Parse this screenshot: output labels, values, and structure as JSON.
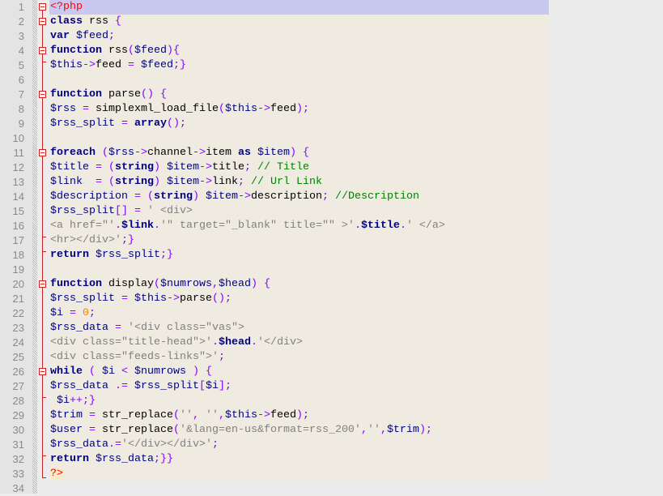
{
  "editor": {
    "colors": {
      "keyword": "#000080",
      "variable": "#000080",
      "operator": "#8000ff",
      "string": "#808080",
      "comment": "#008000",
      "php_tag": "#ff0000",
      "number": "#ff8000",
      "current_line": "#c9c8f0",
      "code_background": "#efebe0"
    },
    "current_line": 1,
    "fold_starts": [
      1,
      2,
      4,
      7,
      11,
      20,
      26
    ],
    "fold_ends": [
      5,
      17,
      18,
      28,
      32,
      33
    ],
    "lines": [
      [
        [
          "t",
          "<?php"
        ]
      ],
      [
        [
          "k",
          "class"
        ],
        [
          "d",
          " rss "
        ],
        [
          "o",
          "{"
        ]
      ],
      [
        [
          "k",
          "var"
        ],
        [
          "d",
          " "
        ],
        [
          "v",
          "$feed"
        ],
        [
          "o",
          ";"
        ]
      ],
      [
        [
          "k",
          "function"
        ],
        [
          "d",
          " rss"
        ],
        [
          "o",
          "("
        ],
        [
          "v",
          "$feed"
        ],
        [
          "o",
          "){"
        ]
      ],
      [
        [
          "v",
          "$this"
        ],
        [
          "o",
          "->"
        ],
        [
          "d",
          "feed "
        ],
        [
          "o",
          "="
        ],
        [
          "d",
          " "
        ],
        [
          "v",
          "$feed"
        ],
        [
          "o",
          ";}"
        ]
      ],
      [],
      [
        [
          "k",
          "function"
        ],
        [
          "d",
          " parse"
        ],
        [
          "o",
          "()"
        ],
        [
          "d",
          " "
        ],
        [
          "o",
          "{"
        ]
      ],
      [
        [
          "v",
          "$rss"
        ],
        [
          "d",
          " "
        ],
        [
          "o",
          "="
        ],
        [
          "d",
          " simplexml_load_file"
        ],
        [
          "o",
          "("
        ],
        [
          "v",
          "$this"
        ],
        [
          "o",
          "->"
        ],
        [
          "d",
          "feed"
        ],
        [
          "o",
          ");"
        ]
      ],
      [
        [
          "v",
          "$rss_split"
        ],
        [
          "d",
          " "
        ],
        [
          "o",
          "="
        ],
        [
          "d",
          " "
        ],
        [
          "k",
          "array"
        ],
        [
          "o",
          "();"
        ]
      ],
      [],
      [
        [
          "k",
          "foreach"
        ],
        [
          "d",
          " "
        ],
        [
          "o",
          "("
        ],
        [
          "v",
          "$rss"
        ],
        [
          "o",
          "->"
        ],
        [
          "d",
          "channel"
        ],
        [
          "o",
          "->"
        ],
        [
          "d",
          "item "
        ],
        [
          "k",
          "as"
        ],
        [
          "d",
          " "
        ],
        [
          "v",
          "$item"
        ],
        [
          "o",
          ")"
        ],
        [
          "d",
          " "
        ],
        [
          "o",
          "{"
        ]
      ],
      [
        [
          "v",
          "$title"
        ],
        [
          "d",
          " "
        ],
        [
          "o",
          "="
        ],
        [
          "d",
          " "
        ],
        [
          "o",
          "("
        ],
        [
          "k",
          "string"
        ],
        [
          "o",
          ")"
        ],
        [
          "d",
          " "
        ],
        [
          "v",
          "$item"
        ],
        [
          "o",
          "->"
        ],
        [
          "d",
          "title"
        ],
        [
          "o",
          ";"
        ],
        [
          "d",
          " "
        ],
        [
          "c",
          "// Title"
        ]
      ],
      [
        [
          "v",
          "$link"
        ],
        [
          "d",
          "  "
        ],
        [
          "o",
          "="
        ],
        [
          "d",
          " "
        ],
        [
          "o",
          "("
        ],
        [
          "k",
          "string"
        ],
        [
          "o",
          ")"
        ],
        [
          "d",
          " "
        ],
        [
          "v",
          "$item"
        ],
        [
          "o",
          "->"
        ],
        [
          "d",
          "link"
        ],
        [
          "o",
          ";"
        ],
        [
          "d",
          " "
        ],
        [
          "c",
          "// Url Link"
        ]
      ],
      [
        [
          "v",
          "$description"
        ],
        [
          "d",
          " "
        ],
        [
          "o",
          "="
        ],
        [
          "d",
          " "
        ],
        [
          "o",
          "("
        ],
        [
          "k",
          "string"
        ],
        [
          "o",
          ")"
        ],
        [
          "d",
          " "
        ],
        [
          "v",
          "$item"
        ],
        [
          "o",
          "->"
        ],
        [
          "d",
          "description"
        ],
        [
          "o",
          ";"
        ],
        [
          "d",
          " "
        ],
        [
          "c",
          "//Description"
        ]
      ],
      [
        [
          "v",
          "$rss_split"
        ],
        [
          "o",
          "[]"
        ],
        [
          "d",
          " "
        ],
        [
          "o",
          "="
        ],
        [
          "d",
          " "
        ],
        [
          "s",
          "' <div>"
        ]
      ],
      [
        [
          "s",
          "<a href=\"'"
        ],
        [
          "o",
          "."
        ],
        [
          "k",
          "$link"
        ],
        [
          "o",
          "."
        ],
        [
          "s",
          "'\" target=\"_blank\" title=\"\" >'"
        ],
        [
          "o",
          "."
        ],
        [
          "k",
          "$title"
        ],
        [
          "o",
          "."
        ],
        [
          "s",
          "' </a>"
        ]
      ],
      [
        [
          "s",
          "<hr></div>'"
        ],
        [
          "o",
          ";}"
        ]
      ],
      [
        [
          "k",
          "return"
        ],
        [
          "d",
          " "
        ],
        [
          "v",
          "$rss_split"
        ],
        [
          "o",
          ";}"
        ]
      ],
      [],
      [
        [
          "k",
          "function"
        ],
        [
          "d",
          " display"
        ],
        [
          "o",
          "("
        ],
        [
          "v",
          "$numrows"
        ],
        [
          "o",
          ","
        ],
        [
          "v",
          "$head"
        ],
        [
          "o",
          ")"
        ],
        [
          "d",
          " "
        ],
        [
          "o",
          "{"
        ]
      ],
      [
        [
          "v",
          "$rss_split"
        ],
        [
          "d",
          " "
        ],
        [
          "o",
          "="
        ],
        [
          "d",
          " "
        ],
        [
          "v",
          "$this"
        ],
        [
          "o",
          "->"
        ],
        [
          "d",
          "parse"
        ],
        [
          "o",
          "();"
        ]
      ],
      [
        [
          "v",
          "$i"
        ],
        [
          "d",
          " "
        ],
        [
          "o",
          "="
        ],
        [
          "d",
          " "
        ],
        [
          "n",
          "0"
        ],
        [
          "o",
          ";"
        ]
      ],
      [
        [
          "v",
          "$rss_data"
        ],
        [
          "d",
          " "
        ],
        [
          "o",
          "="
        ],
        [
          "d",
          " "
        ],
        [
          "s",
          "'<div class=\"vas\">"
        ]
      ],
      [
        [
          "s",
          "<div class=\"title-head\">'"
        ],
        [
          "o",
          "."
        ],
        [
          "k",
          "$head"
        ],
        [
          "o",
          "."
        ],
        [
          "s",
          "'</div>"
        ]
      ],
      [
        [
          "s",
          "<div class=\"feeds-links\">'"
        ],
        [
          "o",
          ";"
        ]
      ],
      [
        [
          "k",
          "while"
        ],
        [
          "d",
          " "
        ],
        [
          "o",
          "("
        ],
        [
          "d",
          " "
        ],
        [
          "v",
          "$i"
        ],
        [
          "d",
          " "
        ],
        [
          "o",
          "<"
        ],
        [
          "d",
          " "
        ],
        [
          "v",
          "$numrows"
        ],
        [
          "d",
          " "
        ],
        [
          "o",
          ")"
        ],
        [
          "d",
          " "
        ],
        [
          "o",
          "{"
        ]
      ],
      [
        [
          "v",
          "$rss_data"
        ],
        [
          "d",
          " "
        ],
        [
          "o",
          ".="
        ],
        [
          "d",
          " "
        ],
        [
          "v",
          "$rss_split"
        ],
        [
          "o",
          "["
        ],
        [
          "v",
          "$i"
        ],
        [
          "o",
          "];"
        ]
      ],
      [
        [
          "d",
          " "
        ],
        [
          "v",
          "$i"
        ],
        [
          "o",
          "++;}"
        ]
      ],
      [
        [
          "v",
          "$trim"
        ],
        [
          "d",
          " "
        ],
        [
          "o",
          "="
        ],
        [
          "d",
          " str_replace"
        ],
        [
          "o",
          "("
        ],
        [
          "s",
          "''"
        ],
        [
          "o",
          ","
        ],
        [
          "d",
          " "
        ],
        [
          "s",
          "''"
        ],
        [
          "o",
          ","
        ],
        [
          "v",
          "$this"
        ],
        [
          "o",
          "->"
        ],
        [
          "d",
          "feed"
        ],
        [
          "o",
          ");"
        ]
      ],
      [
        [
          "v",
          "$user"
        ],
        [
          "d",
          " "
        ],
        [
          "o",
          "="
        ],
        [
          "d",
          " str_replace"
        ],
        [
          "o",
          "("
        ],
        [
          "s",
          "'&lang=en-us&format=rss_200'"
        ],
        [
          "o",
          ","
        ],
        [
          "s",
          "''"
        ],
        [
          "o",
          ","
        ],
        [
          "v",
          "$trim"
        ],
        [
          "o",
          ");"
        ]
      ],
      [
        [
          "v",
          "$rss_data"
        ],
        [
          "o",
          ".="
        ],
        [
          "s",
          "'</div></div>'"
        ],
        [
          "o",
          ";"
        ]
      ],
      [
        [
          "k",
          "return"
        ],
        [
          "d",
          " "
        ],
        [
          "v",
          "$rss_data"
        ],
        [
          "o",
          ";}}"
        ]
      ],
      [
        [
          "te",
          "?>"
        ]
      ],
      []
    ]
  }
}
